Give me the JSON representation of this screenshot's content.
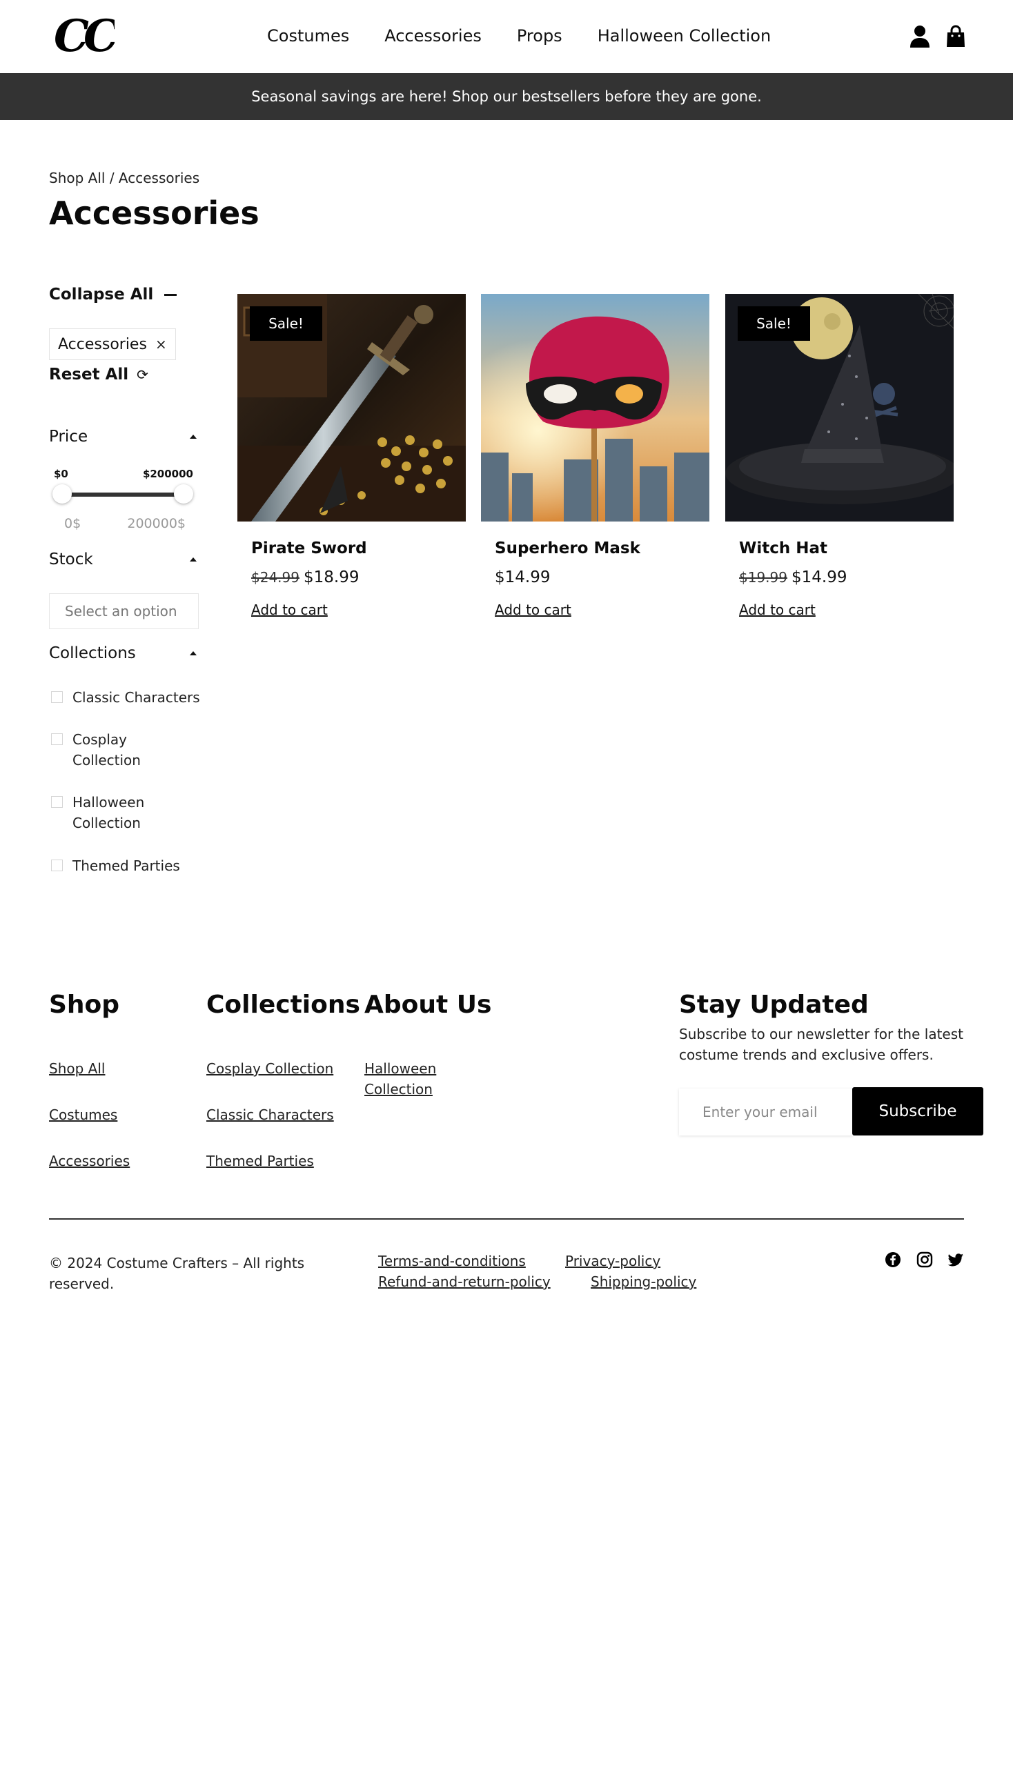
{
  "header": {
    "logo_text": "CC",
    "nav": [
      "Costumes",
      "Accessories",
      "Props",
      "Halloween Collection"
    ]
  },
  "banner": {
    "text": "Seasonal savings are here! Shop our bestsellers before they are gone."
  },
  "breadcrumb": "Shop All / Accessories",
  "page_title": "Accessories",
  "sidebar": {
    "collapse_all": "Collapse All",
    "active_filter": "Accessories",
    "remove_symbol": "×",
    "reset_all": "Reset All",
    "price": {
      "title": "Price",
      "min_label": "$0",
      "max_label": "$200000",
      "min_value": "0$",
      "max_value": "200000$"
    },
    "stock": {
      "title": "Stock",
      "placeholder": "Select an option"
    },
    "collections": {
      "title": "Collections",
      "items": [
        "Classic Characters",
        "Cosplay Collection",
        "Halloween Collection",
        "Themed Parties"
      ]
    }
  },
  "products": [
    {
      "name": "Pirate Sword",
      "badge": "Sale!",
      "old_price": "$24.99",
      "price": "$18.99",
      "cta": "Add to cart"
    },
    {
      "name": "Superhero Mask",
      "badge": "",
      "old_price": "",
      "price": "$14.99",
      "cta": "Add to cart"
    },
    {
      "name": "Witch Hat",
      "badge": "Sale!",
      "old_price": "$19.99",
      "price": "$14.99",
      "cta": "Add to cart"
    }
  ],
  "footer": {
    "shop": {
      "title": "Shop",
      "links": [
        "Shop All",
        "Costumes",
        "Accessories"
      ]
    },
    "collections": {
      "title": "Collections",
      "links": [
        "Cosplay Collection",
        "Classic Characters",
        "Themed Parties"
      ]
    },
    "about": {
      "title": "About Us",
      "links": [
        "Halloween Collection"
      ]
    },
    "newsletter": {
      "title": "Stay Updated",
      "description": "Subscribe to our newsletter for the latest costume trends and exclusive offers.",
      "placeholder": "Enter your email",
      "button": "Subscribe"
    },
    "copyright": "© 2024 Costume Crafters – All rights reserved.",
    "legal": [
      "Terms-and-conditions",
      "Privacy-policy",
      "Refund-and-return-policy",
      "Shipping-policy"
    ],
    "social_icons": [
      "facebook-icon",
      "instagram-icon",
      "twitter-icon"
    ]
  }
}
